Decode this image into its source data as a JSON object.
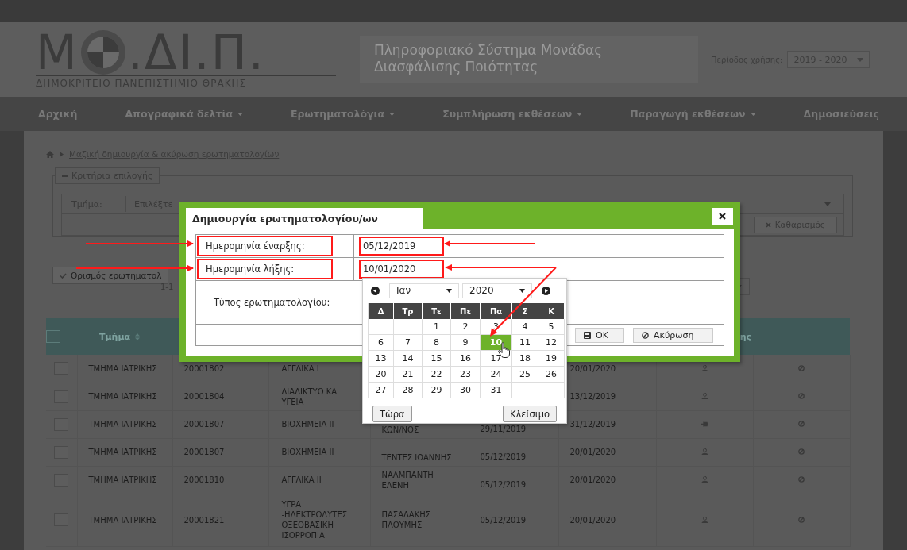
{
  "header": {
    "logo_first": "Μ",
    "logo_rest": ".ΔΙ.Π.",
    "logo_subtitle": "ΔΗΜΟΚΡΙΤΕΙΟ ΠΑΝΕΠΙΣΤΗΜΙΟ ΘΡΑΚΗΣ",
    "system_title": "Πληροφοριακό Σύστημα Μονάδας Διασφάλισης Ποιότητας",
    "period_label": "Περίοδος χρήσης:",
    "period_value": "2019 - 2020"
  },
  "nav": [
    {
      "label": "Αρχική",
      "dropdown": false
    },
    {
      "label": "Απογραφικά δελτία",
      "dropdown": true
    },
    {
      "label": "Ερωτηματολόγια",
      "dropdown": true
    },
    {
      "label": "Συμπλήρωση εκθέσεων",
      "dropdown": true
    },
    {
      "label": "Παραγωγή εκθέσεων",
      "dropdown": true
    },
    {
      "label": "Δημοσιεύσεις",
      "dropdown": false
    }
  ],
  "breadcrumb": "Μαζική δημιουργία & ακύρωση ερωτηματολογίων",
  "filters": {
    "legend": "Κριτήρια επιλογής",
    "department_label": "Τμήμα:",
    "department_placeholder": "Επιλέξτε",
    "clear_button": "Καθαρισμός"
  },
  "define_button": "Ορισμός ερωτηματολ",
  "pagination_text": "1-1",
  "table": {
    "header_checked": false,
    "columns": [
      {},
      {
        "label": "Τμήμα",
        "sortable": true
      },
      {},
      {},
      {},
      {},
      {},
      {
        "label": "ης",
        "sortable": false
      },
      {}
    ],
    "rows": [
      {
        "checked": false,
        "department": "ΤΜΗΜΑ ΙΑΤΡΙΚΗΣ",
        "code": "20001802",
        "course": "ΑΓΓΛΙΚΑ Ι",
        "end": "20/01/2020",
        "kind": "person"
      },
      {
        "checked": false,
        "department": "ΤΜΗΜΑ ΙΑΤΡΙΚΗΣ",
        "code": "20001804",
        "course": "ΔΙΑΔΙΚΤΥΟ ΚΑ\nΥΓΕΙΑ",
        "end": "13/12/2019",
        "kind": "person"
      },
      {
        "checked": false,
        "department": "ΤΜΗΜΑ ΙΑΤΡΙΚΗΣ",
        "code": "20001807",
        "course": "ΒΙΟΧΗΜΕΙΑ ΙΙ",
        "teacher": "ΚΩΝ/ΝΟΣ",
        "start": "29/11/2019",
        "end": "31/12/2019",
        "kind": "pin"
      },
      {
        "checked": false,
        "department": "ΤΜΗΜΑ ΙΑΤΡΙΚΗΣ",
        "code": "20001807",
        "course": "ΒΙΟΧΗΜΕΙΑ ΙΙ",
        "teacher": "ΤΕΝΤΕΣ ΙΩΑΝΝΗΣ",
        "start": "05/12/2019",
        "end": "20/01/2020",
        "kind": "person"
      },
      {
        "checked": false,
        "department": "ΤΜΗΜΑ ΙΑΤΡΙΚΗΣ",
        "code": "20001810",
        "course": "ΑΓΓΛΙΚΑ ΙΙ",
        "teacher": "ΝΑΛΜΠΑΝΤΗ ΕΛΕΝΗ",
        "start": "05/12/2019",
        "end": "20/01/2020",
        "kind": "person"
      },
      {
        "checked": false,
        "department": "ΤΜΗΜΑ ΙΑΤΡΙΚΗΣ",
        "code": "20001821",
        "course": "ΥΓΡΑ -ΗΛΕΚΤΡΟΛΥΤΕΣ ΟΞΕΟΒΑΣΙΚΗ ΙΣΟΡΡΟΠΙΑ",
        "teacher": "ΠΑΣΑΔΑΚΗΣ ΠΛΟΥΜΗΣ",
        "start": "05/12/2019",
        "end": "20/01/2020",
        "kind": "person"
      }
    ]
  },
  "dialog": {
    "title": "Δημιουργία ερωτηματολογίου/ων",
    "fields": [
      {
        "label": "Ημερομηνία έναρξης:",
        "value": "05/12/2019",
        "highlighted": true
      },
      {
        "label": "Ημερομηνία λήξης:",
        "value": "10/01/2020",
        "highlighted": true
      },
      {
        "label": "Τύπος ερωτηματολογίου:",
        "highlighted": false
      }
    ],
    "buttons": [
      {
        "label": "OK",
        "kind": "save"
      },
      {
        "label": "Ακύρωση",
        "kind": "cancel"
      }
    ]
  },
  "calendar": {
    "month": "Ιαν",
    "year": "2020",
    "weekdays": [
      "Δ",
      "Τρ",
      "Τε",
      "Πε",
      "Πα",
      "Σ",
      "Κ"
    ],
    "weeks": [
      {
        "kind": "first",
        "days": [
          {
            "day": "1",
            "selected": false
          },
          {
            "day": "2",
            "selected": false
          },
          {
            "day": "3",
            "selected": false
          },
          {
            "day": "4",
            "selected": false
          },
          {
            "day": "5",
            "selected": false
          }
        ]
      },
      {
        "kind": "middle",
        "days": [
          {
            "day": "6",
            "selected": false
          },
          {
            "day": "7",
            "selected": false
          },
          {
            "day": "8",
            "selected": false
          },
          {
            "day": "9",
            "selected": false
          },
          {
            "day": "10",
            "selected": true
          },
          {
            "day": "11",
            "selected": false
          },
          {
            "day": "12",
            "selected": false
          }
        ]
      },
      {
        "kind": "middle",
        "days": [
          {
            "day": "13",
            "selected": false
          },
          {
            "day": "14",
            "selected": false
          },
          {
            "day": "15",
            "selected": false
          },
          {
            "day": "16",
            "selected": false
          },
          {
            "day": "17",
            "selected": false
          },
          {
            "day": "18",
            "selected": false
          },
          {
            "day": "19",
            "selected": false
          }
        ]
      },
      {
        "kind": "middle",
        "days": [
          {
            "day": "20",
            "selected": false
          },
          {
            "day": "21",
            "selected": false
          },
          {
            "day": "22",
            "selected": false
          },
          {
            "day": "23",
            "selected": false
          },
          {
            "day": "24",
            "selected": false
          },
          {
            "day": "25",
            "selected": false
          },
          {
            "day": "26",
            "selected": false
          }
        ]
      },
      {
        "kind": "last",
        "days": [
          {
            "day": "27",
            "selected": false
          },
          {
            "day": "28",
            "selected": false
          },
          {
            "day": "29",
            "selected": false
          },
          {
            "day": "30",
            "selected": false
          },
          {
            "day": "31",
            "selected": false
          }
        ]
      }
    ],
    "today_button": "Τώρα",
    "close_button": "Κλείσιμο"
  }
}
